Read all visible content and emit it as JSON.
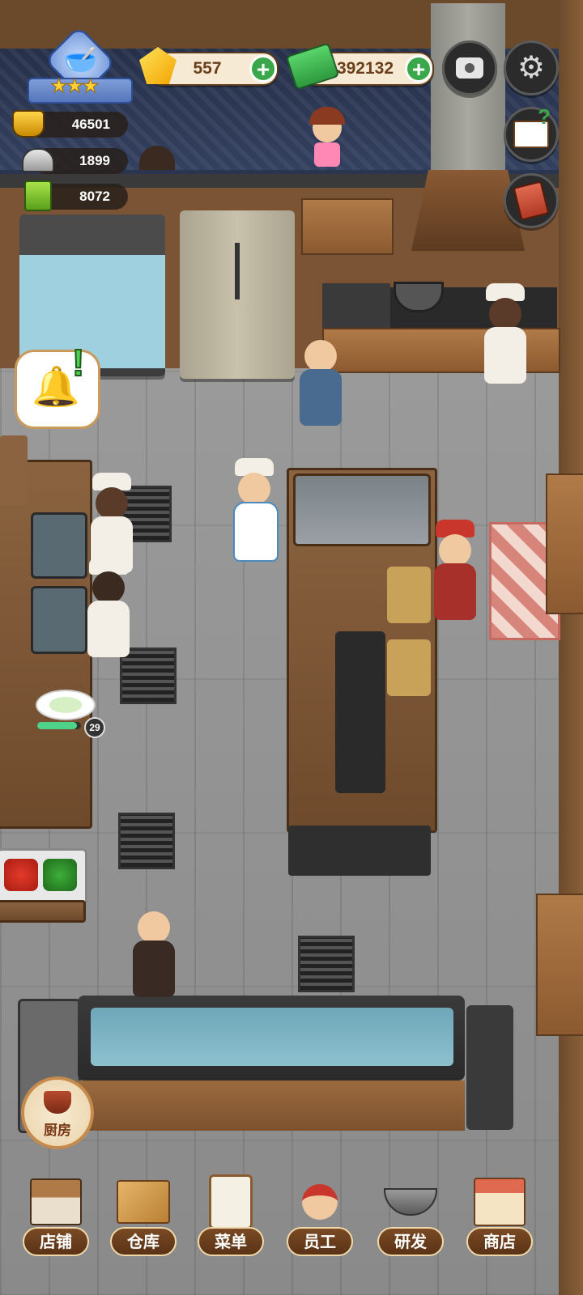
{
  "hud": {
    "gems": "557",
    "cash": "392132",
    "stats": [
      {
        "icon": "cash-pot-icon",
        "value": "46501"
      },
      {
        "icon": "served-dish-icon",
        "value": "1899"
      },
      {
        "icon": "recipe-book-icon",
        "value": "8072"
      }
    ],
    "restaurant_stars": 3
  },
  "prep_progress": {
    "count": "29",
    "fill": 0.9
  },
  "kitchen_button": {
    "label": "厨房"
  },
  "bottom_nav": [
    {
      "label": "店铺",
      "icon": "shop-building-icon"
    },
    {
      "label": "仓库",
      "icon": "warehouse-boxes-icon"
    },
    {
      "label": "菜单",
      "icon": "menu-clipboard-icon"
    },
    {
      "label": "员工",
      "icon": "staff-waitress-icon"
    },
    {
      "label": "研发",
      "icon": "research-wok-icon"
    },
    {
      "label": "商店",
      "icon": "store-stall-icon"
    }
  ],
  "colors": {
    "plus_green": "#3aa84a",
    "label_brown": "#5a3216",
    "progress_green": "#4fd18a"
  }
}
